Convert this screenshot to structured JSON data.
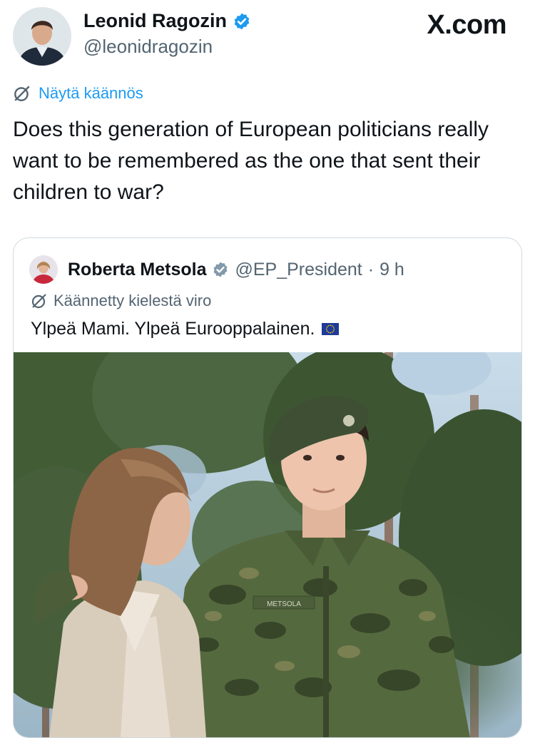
{
  "author": {
    "name": "Leonid Ragozin",
    "handle": "@leonidragozin",
    "verified": true
  },
  "brand": {
    "logo_text": "X.com"
  },
  "translate_link": "Näytä käännös",
  "tweet_text": "Does this generation of European politicians really want to be remembered as the one that sent their children to war?",
  "quote": {
    "name": "Roberta Metsola",
    "handle": "@EP_President",
    "separator": "·",
    "time": "9 h",
    "translated_note": "Käännetty kielestä viro",
    "text": "Ylpeä Mami. Ylpeä Eurooppalainen.",
    "photo_name_tag": "METSOLA"
  },
  "icons": {
    "verified": "verified-badge-icon",
    "translate": "translate-icon",
    "flag": "eu-flag-icon"
  },
  "colors": {
    "accent": "#1d9bf0",
    "text": "#0f1419",
    "secondary": "#536471",
    "border": "#cfd9de",
    "quote_verified": "#829aab"
  }
}
